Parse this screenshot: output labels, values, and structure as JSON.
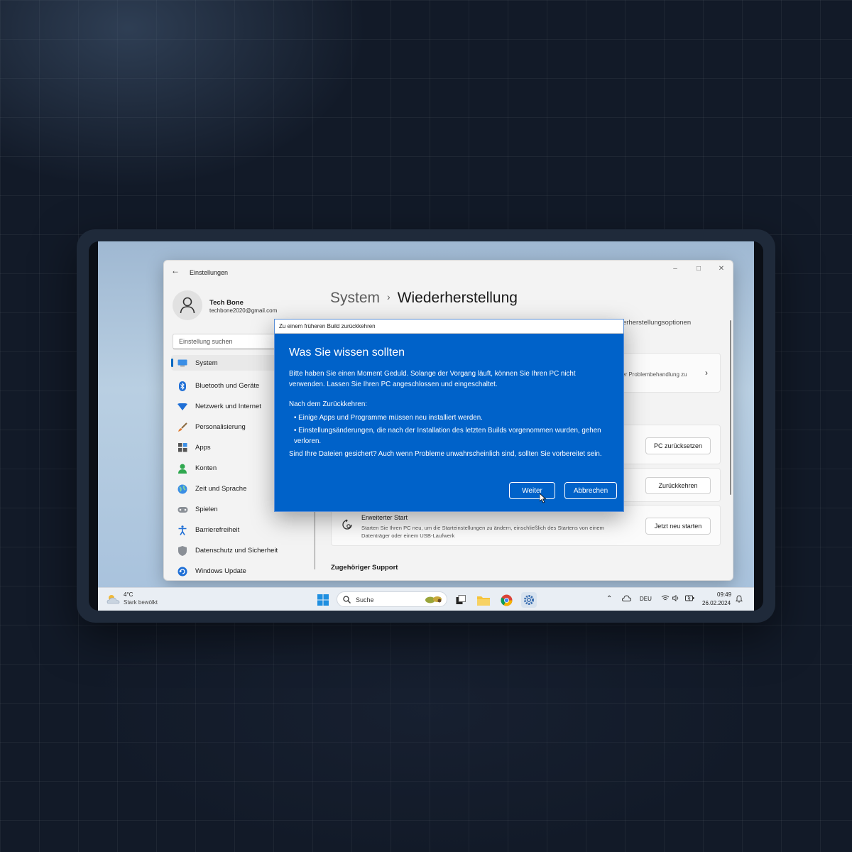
{
  "window": {
    "title": "Einstellungen",
    "user": {
      "name": "Tech Bone",
      "email": "techbone2020@gmail.com"
    },
    "search_placeholder": "Einstellung suchen",
    "nav": [
      {
        "label": "System",
        "icon": "monitor-icon"
      },
      {
        "label": "Bluetooth und Geräte",
        "icon": "bluetooth-icon"
      },
      {
        "label": "Netzwerk und Internet",
        "icon": "wifi-icon"
      },
      {
        "label": "Personalisierung",
        "icon": "brush-icon"
      },
      {
        "label": "Apps",
        "icon": "apps-icon"
      },
      {
        "label": "Konten",
        "icon": "account-icon"
      },
      {
        "label": "Zeit und Sprache",
        "icon": "globe-icon"
      },
      {
        "label": "Spielen",
        "icon": "gamepad-icon"
      },
      {
        "label": "Barrierefreiheit",
        "icon": "accessibility-icon"
      },
      {
        "label": "Datenschutz und Sicherheit",
        "icon": "shield-icon"
      },
      {
        "label": "Windows Update",
        "icon": "update-icon"
      }
    ],
    "breadcrumb": {
      "parent": "System",
      "current": "Wiederherstellung"
    },
    "subtext": "erherstellungsoptionen",
    "troubleshoot_text": "er Problembehandlung zu",
    "buttons": {
      "reset": "PC zurücksetzen",
      "go_back": "Zurückkehren",
      "restart": "Jetzt neu starten"
    },
    "advanced_start": {
      "title": "Erweiterter Start",
      "description": "Starten Sie Ihren PC neu, um die Starteinstellungen zu ändern, einschließlich des Startens von einem Datenträger oder einem USB-Laufwerk"
    },
    "support_heading": "Zugehöriger Support"
  },
  "dialog": {
    "title": "Zu einem früheren Build zurückkehren",
    "heading": "Was Sie wissen sollten",
    "para1": "Bitte haben Sie einen Moment Geduld. Solange der Vorgang läuft, können Sie Ihren PC nicht verwenden. Lassen Sie Ihren PC angeschlossen und eingeschaltet.",
    "para2": "Nach dem Zurückkehren:",
    "bullets": [
      "• Einige Apps und Programme müssen neu installiert werden.",
      "• Einstellungsänderungen, die nach der Installation des letzten Builds vorgenommen wurden, gehen verloren."
    ],
    "para3": "Sind Ihre Dateien gesichert? Auch wenn Probleme unwahrscheinlich sind, sollten Sie vorbereitet sein.",
    "next_label": "Weiter",
    "cancel_label": "Abbrechen"
  },
  "taskbar": {
    "weather_temp": "4°C",
    "weather_desc": "Stark bewölkt",
    "search_label": "Suche",
    "language": "DEU",
    "time": "09:49",
    "date": "26.02.2024"
  },
  "colors": {
    "dialog_blue": "#0062c9",
    "accent": "#0067c0"
  }
}
